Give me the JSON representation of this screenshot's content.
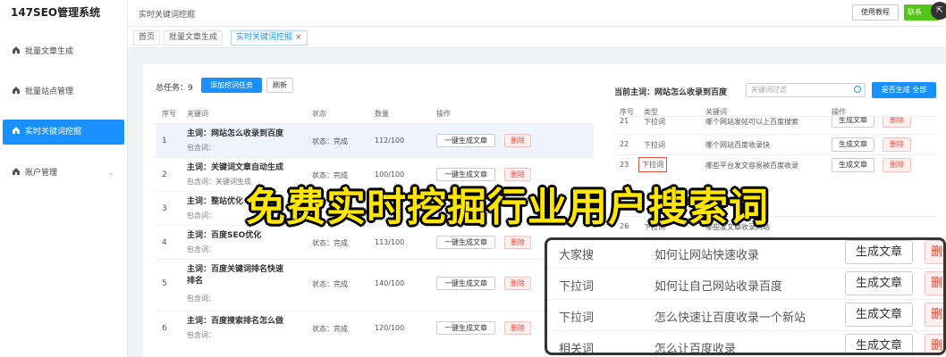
{
  "app": {
    "brand": "147SEO管理系统",
    "breadcrumb": "实时关键词挖掘",
    "help_button": "使用教程",
    "contact_button": "联系"
  },
  "sidebar": {
    "items": [
      {
        "label": "批量文章生成",
        "icon": "home-icon"
      },
      {
        "label": "批量站点管理",
        "icon": "home-icon"
      },
      {
        "label": "实时关键词挖掘",
        "icon": "home-icon",
        "active": true
      },
      {
        "label": "账户管理",
        "icon": "home-icon",
        "expandable": true
      }
    ]
  },
  "tabs": [
    {
      "label": "首页"
    },
    {
      "label": "批量文章生成"
    },
    {
      "label": "实时关键词挖掘",
      "active": true,
      "closable": true
    }
  ],
  "tasks": {
    "total_label": "总任务：9",
    "add_button": "添加挖词任务",
    "refresh_button": "刷新",
    "columns": {
      "index": "序号",
      "keyword": "关键词",
      "status": "状态",
      "quantity": "数量",
      "actions": "操作"
    },
    "gen_button": "一键生成文章",
    "del_button": "删除",
    "rows": [
      {
        "index": "1",
        "main": "主词：网站怎么收录到百度",
        "sub": "包含词：",
        "status": "状态：完成",
        "qty": "112/100"
      },
      {
        "index": "2",
        "main": "主词：关键词文章自动生成",
        "sub": "包含词：关键词生成",
        "status": "状态：完成",
        "qty": "100/100"
      },
      {
        "index": "3",
        "main": "主词：整站优化",
        "sub": "包含词：",
        "status": "",
        "qty": ""
      },
      {
        "index": "4",
        "main": "主词：百度SEO优化",
        "sub": "包含词：",
        "status": "状态：完成",
        "qty": "113/100"
      },
      {
        "index": "5",
        "main": "主词：百度关键词排名快速排名",
        "sub": "包含词：",
        "status": "状态：完成",
        "qty": "140/100"
      },
      {
        "index": "6",
        "main": "主词：百度搜索排名怎么做",
        "sub": "包含词：",
        "status": "状态：完成",
        "qty": "120/100"
      }
    ]
  },
  "keywords_panel": {
    "title": "当前主词：网站怎么收录到百度",
    "search_placeholder": "关键词过滤",
    "gen_all_button": "是否生成 全部",
    "columns": {
      "no": "序号",
      "type": "类型",
      "keyword": "关键词",
      "actions": "操作"
    },
    "gen_button": "生成文章",
    "rows": [
      {
        "no": "21",
        "type": "下拉词",
        "keyword": "哪个网站发帖可以上百度搜索"
      },
      {
        "no": "22",
        "type": "下拉词",
        "keyword": "哪个网站百度收录快"
      },
      {
        "no": "23",
        "type": "下拉词",
        "keyword": "哪些平台发文容易被百度收录"
      },
      {
        "no": "26",
        "type": "下拉词",
        "keyword": "哪些发文章收录网站"
      }
    ]
  },
  "banner": "免费实时挖掘行业用户搜索词",
  "zoom": {
    "gen_button": "生成文章",
    "del_button": "删",
    "rows": [
      {
        "type": "大家搜",
        "keyword": "如何让网站快速收录"
      },
      {
        "type": "下拉词",
        "keyword": "如何让自己网站收录百度"
      },
      {
        "type": "下拉词",
        "keyword": "怎么快速让百度收录一个新站"
      },
      {
        "type": "相关词",
        "keyword": "怎么让百度收录"
      }
    ]
  },
  "colors": {
    "accent": "#1890ff",
    "banner": "#ffe600",
    "danger": "#e74c3c",
    "green": "#52c41a"
  }
}
